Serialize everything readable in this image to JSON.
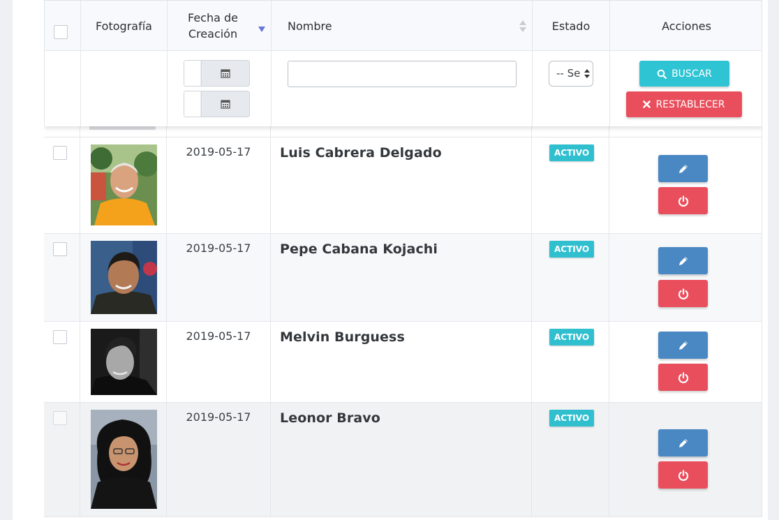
{
  "table": {
    "headers": {
      "photo": "Fotografía",
      "date": "Fecha de Creación",
      "name": "Nombre",
      "status": "Estado",
      "actions": "Acciones"
    },
    "filters": {
      "name_value": "",
      "status_select": "-- Se",
      "search_label": "BUSCAR",
      "reset_label": "RESTABLECER"
    },
    "rows": [
      {
        "date": "2019-05-17",
        "name": "Luis Cabrera Delgado",
        "status": "ACTIVO"
      },
      {
        "date": "2019-05-17",
        "name": "Pepe Cabana Kojachi",
        "status": "ACTIVO"
      },
      {
        "date": "2019-05-17",
        "name": "Melvin Burguess",
        "status": "ACTIVO"
      },
      {
        "date": "2019-05-17",
        "name": "Leonor Bravo",
        "status": "ACTIVO"
      }
    ]
  },
  "colors": {
    "badge": "#2fbfcf",
    "edit": "#4a88c3",
    "power": "#e94e5c",
    "search": "#2fc4d4",
    "sort_active": "#6b77d8"
  },
  "icons": {
    "calendar": "calendar-icon",
    "search": "search-icon",
    "reset": "close-icon",
    "edit": "pencil-icon",
    "power": "power-icon"
  }
}
